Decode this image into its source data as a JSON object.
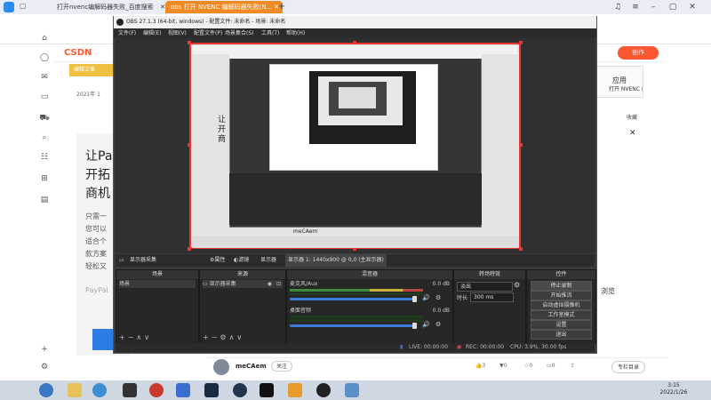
{
  "browser": {
    "tabs": [
      {
        "label": "打开nvenc编解码器失败_百度搜索"
      },
      {
        "label": "obs 打开 NVENC 编解码器失败(N..."
      }
    ]
  },
  "csdn": {
    "logo": "CSDN",
    "creator_button": "创作",
    "banner": "编辑文章",
    "date": "2021年 1",
    "big_lines": [
      "让Pa",
      "开拓",
      "商机"
    ],
    "small_lines": [
      "只需一",
      "您可以",
      "适合个",
      "款方案",
      "轻松又"
    ],
    "paypal": "PayPal",
    "app_title": "应用",
    "app_sub": "打开 NVENC 编解码",
    "collect": "收藏",
    "author": "meCAem",
    "follow": "关注",
    "stats": [
      "3",
      "0",
      "0",
      "0"
    ],
    "catalog": "专栏目录",
    "preview_label": "浏览"
  },
  "obs": {
    "title": "OBS 27.1.3 (64-bit, windows) - 配置文件: 未命名 - 场景: 未命名",
    "menu": [
      "文件(F)",
      "编辑(E)",
      "视图(V)",
      "配置文件(P)",
      "场景集合(S)",
      "工具(T)",
      "帮助(H)"
    ],
    "source_bar": {
      "source_name": "显示器采集",
      "props": "属性",
      "filters": "滤镜",
      "display": "显示器",
      "display_value": "显示器 1: 1440x900 @ 0,0 (主显示器)"
    },
    "docks": {
      "scenes": {
        "title": "场景",
        "items": [
          "场景"
        ]
      },
      "sources": {
        "title": "来源",
        "items": [
          "显示器采集"
        ]
      },
      "mixer": {
        "title": "混音器",
        "channels": [
          {
            "name": "麦克风/Aux",
            "db": "0.0 dB"
          },
          {
            "name": "桌面音频",
            "db": "0.0 dB"
          }
        ]
      },
      "transitions": {
        "title": "转场特效",
        "type": "淡出",
        "duration_label": "时长",
        "duration_value": "300 ms"
      },
      "controls": {
        "title": "控件",
        "buttons": [
          "停止录制",
          "开始推流",
          "启动虚拟摄像机",
          "工作室模式",
          "设置",
          "退出"
        ]
      }
    },
    "status": {
      "live": "LIVE: 00:00:00",
      "rec": "REC: 00:00:00",
      "cpu": "CPU: 3.9%, 30.00 fps"
    },
    "nested_user": "meCAem"
  },
  "taskbar": {
    "time": "3:15",
    "date": "2022/1/26"
  },
  "colors": {
    "obs_bg": "#3a3a3a",
    "capture_border": "#e33333",
    "csdn_red": "#fc5531",
    "tab_active": "#f08a24"
  }
}
